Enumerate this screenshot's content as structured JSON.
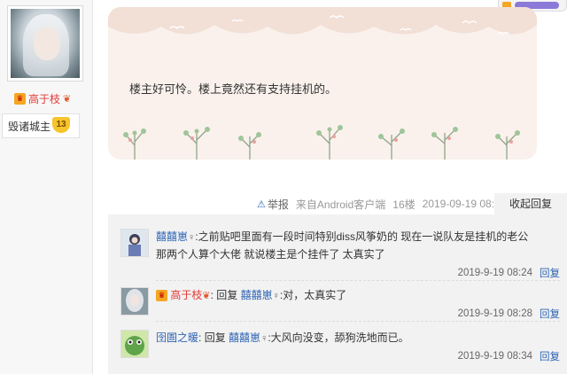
{
  "sidebar": {
    "username": "高于枝",
    "rank_name": "毁诸城主",
    "rank_level": "13"
  },
  "post": {
    "text": "楼主好可怜。楼上竟然还有支持挂机的。"
  },
  "meta": {
    "report_label": "举报",
    "source": "来自Android客户端",
    "floor": "16楼",
    "datetime": "2019-09-19 08:22",
    "collapse_label": "收起回复"
  },
  "comments": [
    {
      "user": "囍囍崽",
      "text_line1": ":之前贴吧里面有一段时间特别diss风筝奶的 现在一说队友是挂机的老公",
      "text_line2": "那两个人算个大佬 就说楼主是个挂件了 太真实了",
      "time": "2019-9-19 08:24",
      "reply_label": "回复"
    },
    {
      "user": "高于枝",
      "prefix": "回复",
      "target": "囍囍崽",
      "text": ":对，太真实了",
      "time": "2019-9-19 08:28",
      "reply_label": "回复"
    },
    {
      "user": "囹圄之暖",
      "prefix": "回复",
      "target": "囍囍崽",
      "text": ":大风向没变，舔狗洗地而已。",
      "time": "2019-9-19 08:34",
      "reply_label": "回复"
    }
  ]
}
